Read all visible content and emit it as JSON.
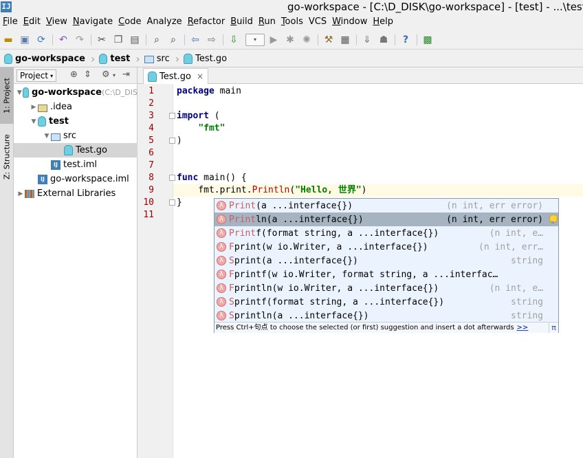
{
  "window": {
    "title": "go-workspace - [C:\\D_DISK\\go-workspace] - [test] - ...\\test",
    "app_icon": "IJ"
  },
  "menu": [
    {
      "label": "File",
      "mnemonic": "F",
      "rest": "ile"
    },
    {
      "label": "Edit",
      "mnemonic": "E",
      "rest": "dit"
    },
    {
      "label": "View",
      "mnemonic": "V",
      "rest": "iew"
    },
    {
      "label": "Navigate",
      "mnemonic": "N",
      "rest": "avigate"
    },
    {
      "label": "Code",
      "mnemonic": "C",
      "rest": "ode"
    },
    {
      "label": "Analyze",
      "mnemonic": "",
      "rest": "Analyze"
    },
    {
      "label": "Refactor",
      "mnemonic": "R",
      "rest": "efactor"
    },
    {
      "label": "Build",
      "mnemonic": "B",
      "rest": "uild"
    },
    {
      "label": "Run",
      "mnemonic": "R",
      "rest": "un"
    },
    {
      "label": "Tools",
      "mnemonic": "T",
      "rest": "ools"
    },
    {
      "label": "VCS",
      "mnemonic": "",
      "rest": "VCS"
    },
    {
      "label": "Window",
      "mnemonic": "W",
      "rest": "indow"
    },
    {
      "label": "Help",
      "mnemonic": "H",
      "rest": "elp"
    }
  ],
  "toolbar": {
    "icons": [
      "open-folder-icon",
      "save-icon",
      "sync-icon",
      "undo-icon",
      "redo-icon",
      "cut-icon",
      "copy-icon",
      "paste-icon",
      "find-icon",
      "replace-icon",
      "back-icon",
      "forward-icon",
      "build-icon",
      "run-config-combo",
      "run-icon",
      "debug-icon",
      "profile-icon",
      "stop-icon",
      "settings-icon",
      "project-structure-icon",
      "sdk-icon",
      "android-icon",
      "help-icon",
      "plugin-icon"
    ],
    "run_config_label": "▾"
  },
  "breadcrumb": [
    {
      "label": "go-workspace",
      "icon": "gopher-icon",
      "bold": true
    },
    {
      "label": "test",
      "icon": "gopher-icon",
      "bold": true
    },
    {
      "label": "src",
      "icon": "folder-icon",
      "bold": false
    },
    {
      "label": "Test.go",
      "icon": "gofile-icon",
      "bold": false
    }
  ],
  "tool_strip": {
    "project_tab": "1: Project",
    "structure_tab": "Z: Structure"
  },
  "project_panel": {
    "view_selector": "Project",
    "tree": [
      {
        "label": "go-workspace",
        "hint": " (C:\\D_DIS",
        "depth": 0,
        "expanded": true,
        "icon": "gopher",
        "bold": true
      },
      {
        "label": ".idea",
        "depth": 1,
        "expanded": false,
        "icon": "folder",
        "bold": false
      },
      {
        "label": "test",
        "depth": 1,
        "expanded": true,
        "icon": "gopher",
        "bold": true
      },
      {
        "label": "src",
        "depth": 2,
        "expanded": true,
        "icon": "folder-blue",
        "bold": false
      },
      {
        "label": "Test.go",
        "depth": 3,
        "icon": "gofile",
        "bold": false,
        "selected": true
      },
      {
        "label": "test.iml",
        "depth": 2,
        "icon": "iml",
        "bold": false
      },
      {
        "label": "go-workspace.iml",
        "depth": 1,
        "icon": "iml",
        "bold": false
      },
      {
        "label": "External Libraries",
        "depth": 0,
        "expanded": false,
        "icon": "library",
        "bold": false
      }
    ]
  },
  "editor": {
    "tab": {
      "label": "Test.go",
      "close": "×"
    },
    "line_numbers": [
      "1",
      "2",
      "3",
      "4",
      "5",
      "6",
      "7",
      "8",
      "9",
      "10",
      "11"
    ],
    "current_line": 9,
    "code": {
      "l1_kw": "package",
      "l1_rest": " main",
      "l3_kw": "import",
      "l3_rest": " (",
      "l4_indent": "    ",
      "l4_str": "\"fmt\"",
      "l5": ")",
      "l8_kw": "func",
      "l8_rest": " main() {",
      "l9_pre": "    fmt.print.",
      "l9_fn": "Println",
      "l9_open": "(",
      "l9_str": "\"Hello, 世界\"",
      "l9_close": ")",
      "l10": "}"
    }
  },
  "completion": {
    "items": [
      {
        "match": "Print",
        "name_rest": "",
        "sig": "(a ...interface{})",
        "type": "(n int, err error)",
        "selected": false
      },
      {
        "match": "Print",
        "name_rest": "ln",
        "sig": "(a ...interface{})",
        "type": "(n int, err error)",
        "selected": true
      },
      {
        "match": "Print",
        "name_rest": "f",
        "sig": "(format string, a ...interface{})",
        "type": "(n int, e…",
        "selected": false
      },
      {
        "match": "F",
        "name_rest": "print",
        "sig": "(w io.Writer, a ...interface{})",
        "type": "(n int, err…",
        "selected": false
      },
      {
        "match": "S",
        "name_rest": "print",
        "sig": "(a ...interface{})",
        "type": "string",
        "selected": false
      },
      {
        "match": "F",
        "name_rest": "printf",
        "sig": "(w io.Writer, format string, a ...interfac…",
        "type": "",
        "selected": false
      },
      {
        "match": "F",
        "name_rest": "println",
        "sig": "(w io.Writer, a ...interface{})",
        "type": "(n int, e…",
        "selected": false
      },
      {
        "match": "S",
        "name_rest": "printf",
        "sig": "(format string, a ...interface{})",
        "type": "string",
        "selected": false
      },
      {
        "match": "S",
        "name_rest": "println",
        "sig": "(a ...interface{})",
        "type": "string",
        "selected": false
      }
    ],
    "footer_text": "Press Ctrl+句点 to choose the selected (or first) suggestion and insert a dot afterwards",
    "footer_link": ">>",
    "pi": "π"
  }
}
